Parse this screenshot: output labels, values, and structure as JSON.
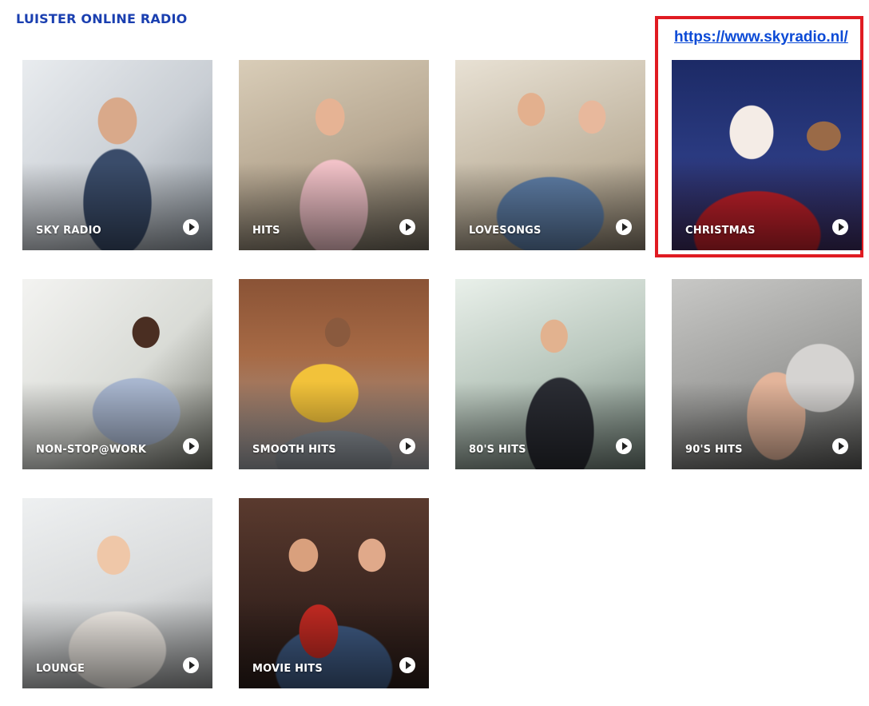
{
  "header": {
    "title": "LUISTER ONLINE RADIO"
  },
  "annotation": {
    "link_text": "https://www.skyradio.nl/",
    "box_color": "#e01b22"
  },
  "stations": [
    {
      "label": "SKY RADIO"
    },
    {
      "label": "HITS"
    },
    {
      "label": "LOVESONGS"
    },
    {
      "label": "CHRISTMAS"
    },
    {
      "label": "NON-STOP@WORK"
    },
    {
      "label": "SMOOTH HITS"
    },
    {
      "label": "80'S HITS"
    },
    {
      "label": "90'S HITS"
    },
    {
      "label": "LOUNGE"
    },
    {
      "label": "MOVIE HITS"
    }
  ],
  "play_icon": "play-circle-icon",
  "colors": {
    "title": "#1a3fb0",
    "link": "#0b4ad6",
    "label": "#ffffff"
  }
}
